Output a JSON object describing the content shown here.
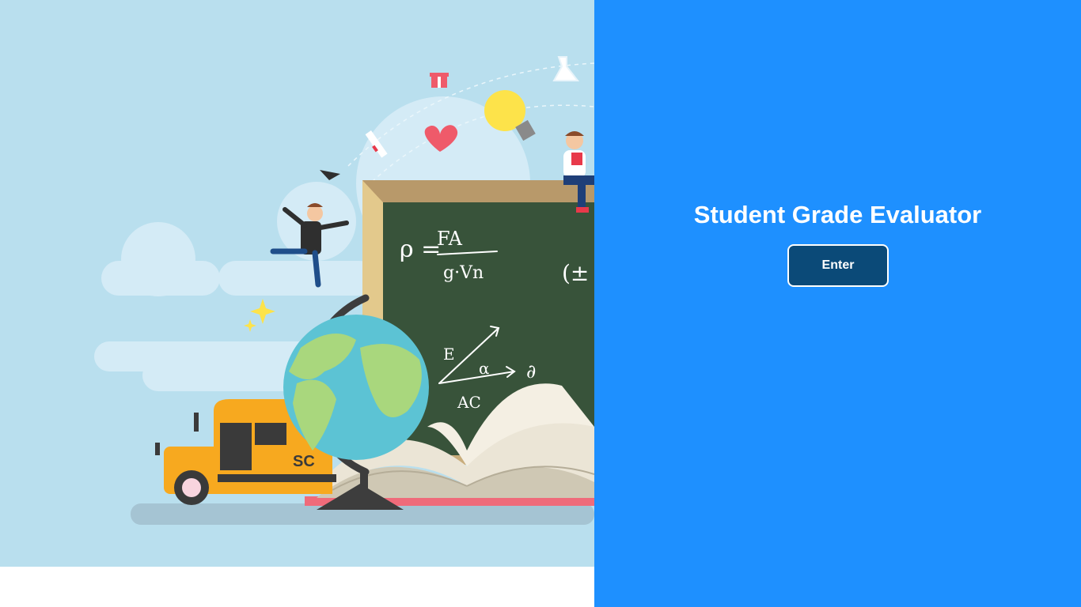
{
  "app": {
    "title": "Student Grade Evaluator",
    "enter_label": "Enter"
  },
  "illustration": {
    "subject": "education-illustration",
    "chalkboard_formulas": [
      "ρ = FA / g·Vn",
      "(±",
      "E",
      "α",
      "AC",
      "∂"
    ],
    "bus_text": "SC"
  },
  "colors": {
    "right_panel": "#1e90ff",
    "button": "#0b4a78",
    "sky": "#b9dfee",
    "chalkboard": "#38533a"
  }
}
